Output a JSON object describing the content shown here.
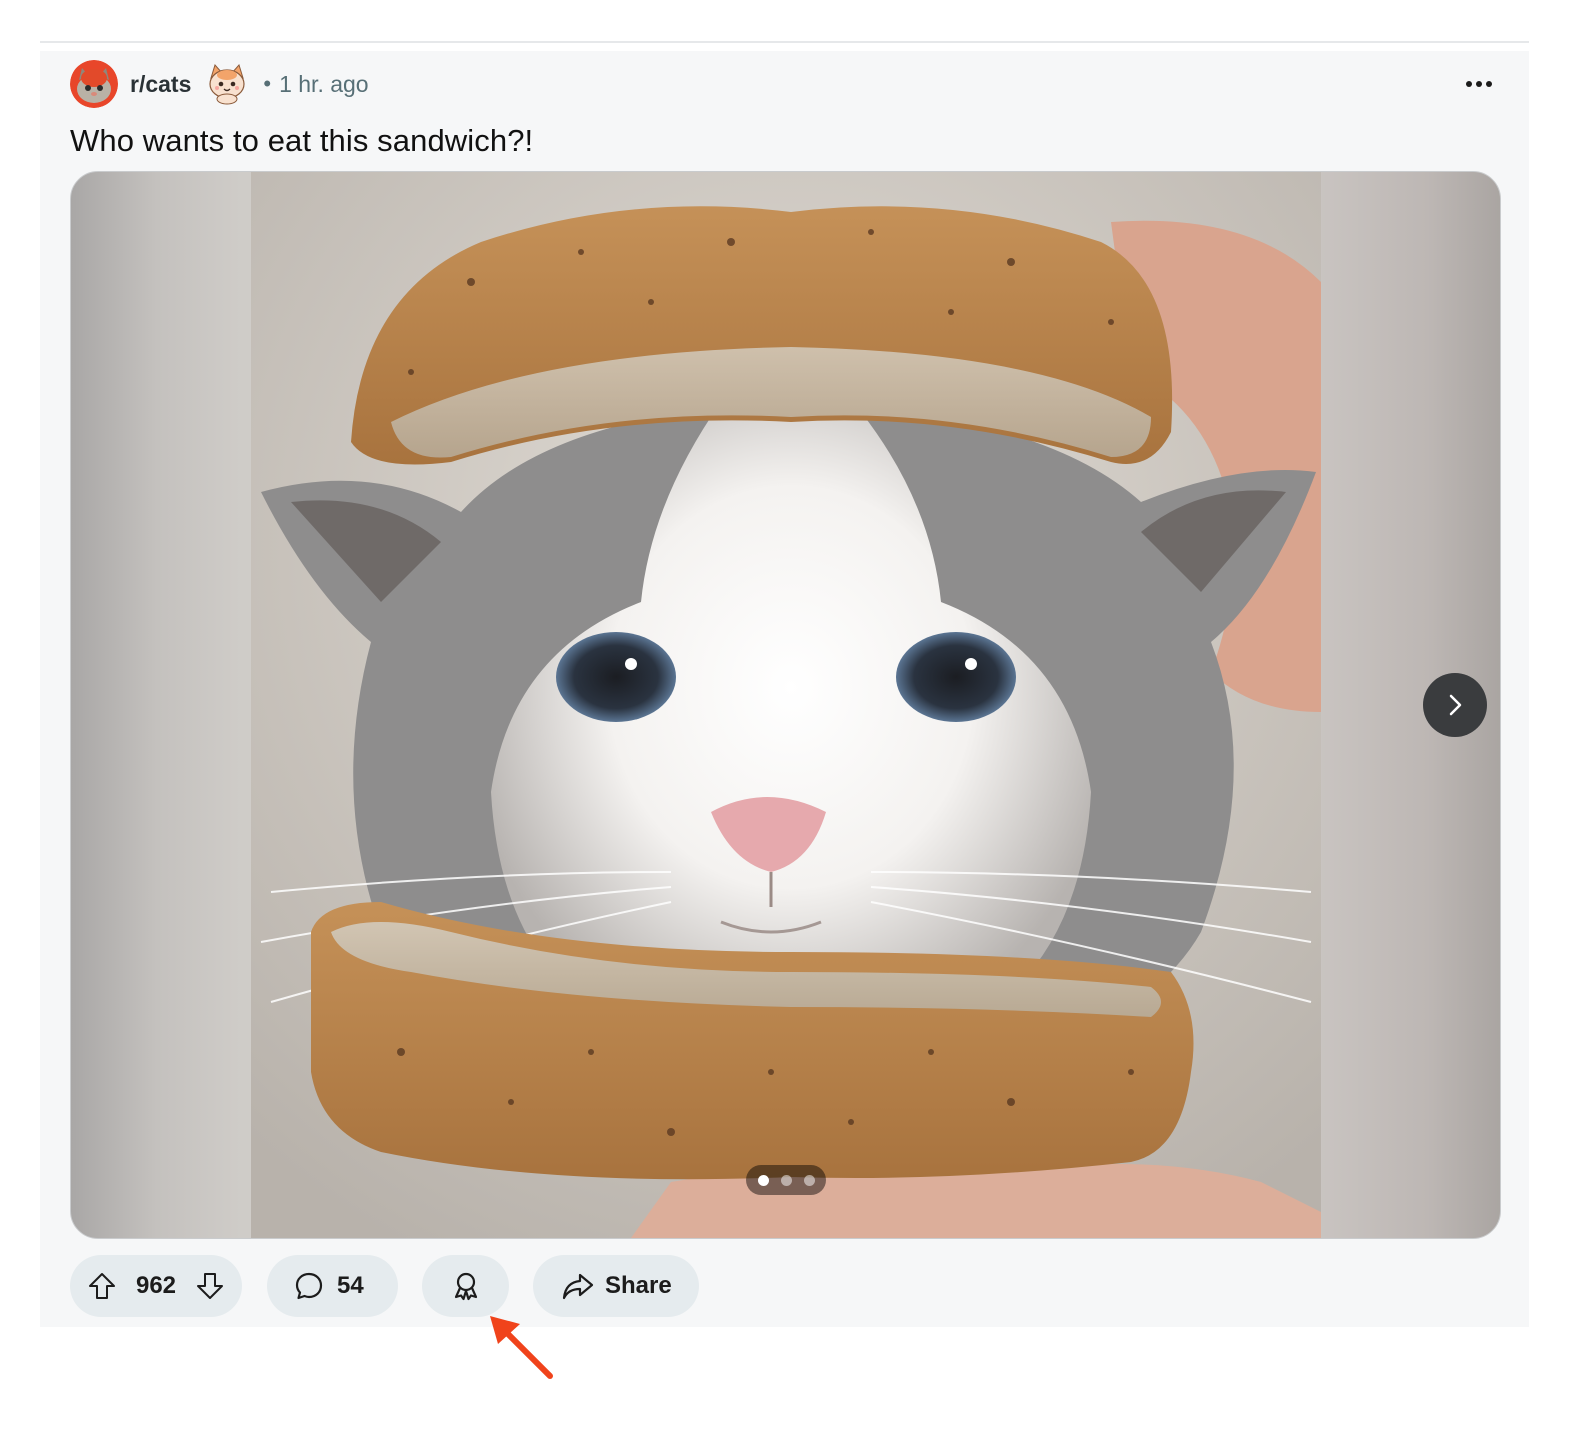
{
  "post": {
    "subreddit": "r/cats",
    "separator": "•",
    "time": "1 hr. ago",
    "title": "Who wants to eat this sandwich?!",
    "overflow_icon": "more-horizontal-icon"
  },
  "gallery": {
    "current_index": 1,
    "total": 3,
    "next_icon": "chevron-right-icon"
  },
  "actions": {
    "vote_count": "962",
    "comment_count": "54",
    "share_label": "Share",
    "upvote_icon": "arrow-up-icon",
    "downvote_icon": "arrow-down-icon",
    "comment_icon": "speech-bubble-icon",
    "award_icon": "award-ribbon-icon",
    "share_icon": "share-arrow-icon"
  },
  "annotation": {
    "color": "#f0431b",
    "target": "award-button"
  },
  "colors": {
    "card_bg": "#f6f7f8",
    "pill_bg": "#e5ebee",
    "meta_text": "#576f76",
    "brand": "#ff4500"
  }
}
